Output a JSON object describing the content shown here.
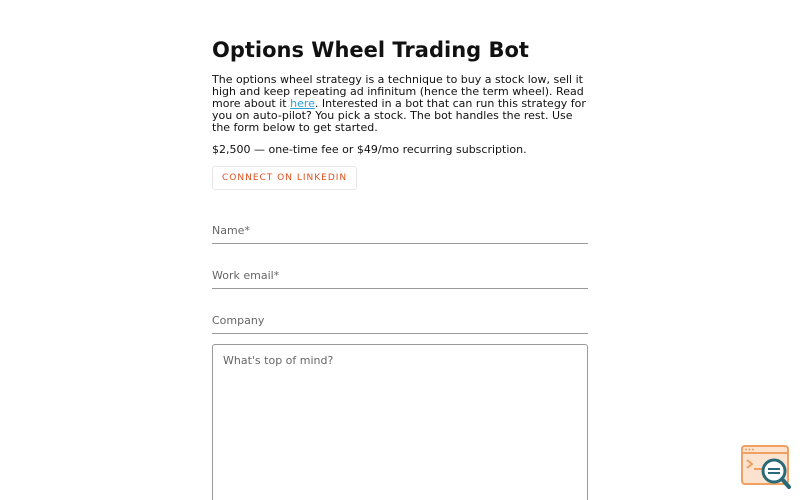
{
  "header": {
    "title": "Options Wheel Trading Bot"
  },
  "intro": {
    "text_before_link": "The options wheel strategy is a technique to buy a stock low, sell it high and keep repeating ad infinitum (hence the term wheel). Read more about it ",
    "link_label": "here",
    "text_after_link": ". Interested in a bot that can run this strategy for you on auto-pilot? You pick a stock. The bot handles the rest. Use the form below to get started."
  },
  "pricing": {
    "text": "$2,500 — one-time fee or $49/mo recurring subscription."
  },
  "buttons": {
    "linkedin_label": "CONNECT ON LINKEDIN"
  },
  "form": {
    "name_placeholder": "Name*",
    "email_placeholder": "Work email*",
    "company_placeholder": "Company",
    "message_placeholder": "What's top of mind?"
  },
  "colors": {
    "link": "#2a9fd8",
    "linkedin_accent": "#e05020",
    "widget_orange": "#f0a060",
    "widget_teal": "#2a6a78"
  },
  "widget": {
    "icon": "chat-search-icon"
  }
}
